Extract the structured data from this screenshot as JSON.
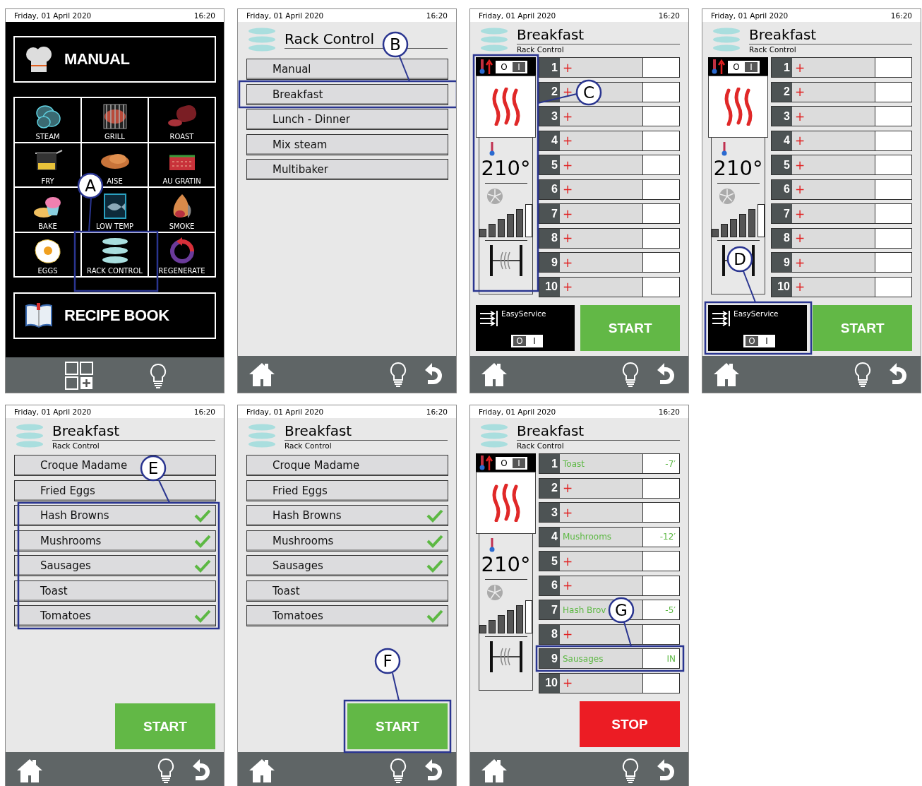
{
  "screens": [
    {
      "kind": "home",
      "date": "Friday, 01 April 2020",
      "time": "16:20",
      "manual": "MANUAL",
      "recipe_book": "RECIPE BOOK",
      "callout": "A",
      "tiles": [
        {
          "label": "STEAM"
        },
        {
          "label": "GRILL"
        },
        {
          "label": "ROAST"
        },
        {
          "label": "FRY"
        },
        {
          "label": "AISE"
        },
        {
          "label": "AU GRATIN"
        },
        {
          "label": "BAKE"
        },
        {
          "label": "LOW TEMP"
        },
        {
          "label": "SMOKE"
        },
        {
          "label": "EGGS"
        },
        {
          "label": "RACK CONTROL"
        },
        {
          "label": "REGENERATE"
        }
      ]
    },
    {
      "kind": "menu",
      "date": "Friday, 01 April 2020",
      "time": "16:20",
      "title": "Rack Control",
      "callout": "B",
      "items": [
        {
          "label": "Manual"
        },
        {
          "label": "Breakfast"
        },
        {
          "label": "Lunch - Dinner"
        },
        {
          "label": "Mix steam"
        },
        {
          "label": "Multibaker"
        }
      ]
    },
    {
      "kind": "racks",
      "date": "Friday, 01 April 2020",
      "time": "16:20",
      "title": "Breakfast",
      "subtitle": "Rack Control",
      "callout": "C",
      "heat_toggle": {
        "off": "O",
        "on_label": "I",
        "on": true
      },
      "temperature": "210°",
      "fan": {
        "level": 0.83
      },
      "racks": [
        {
          "number": "1",
          "kind": "empty",
          "label": "+"
        },
        {
          "number": "2",
          "kind": "empty",
          "label": "+"
        },
        {
          "number": "3",
          "kind": "empty",
          "label": "+"
        },
        {
          "number": "4",
          "kind": "empty",
          "label": "+"
        },
        {
          "number": "5",
          "kind": "empty",
          "label": "+"
        },
        {
          "number": "6",
          "kind": "empty",
          "label": "+"
        },
        {
          "number": "7",
          "kind": "empty",
          "label": "+"
        },
        {
          "number": "8",
          "kind": "empty",
          "label": "+"
        },
        {
          "number": "9",
          "kind": "empty",
          "label": "+"
        },
        {
          "number": "10",
          "kind": "empty",
          "label": "+"
        }
      ],
      "easy_service": {
        "label": "EasyService",
        "off": "O",
        "on_label": "I",
        "on": false
      },
      "action": {
        "kind": "start",
        "label": "START"
      }
    },
    {
      "kind": "racks",
      "date": "Friday, 01 April 2020",
      "time": "16:20",
      "title": "Breakfast",
      "subtitle": "Rack Control",
      "callout": "D",
      "heat_toggle": {
        "off": "O",
        "on_label": "I",
        "on": true
      },
      "temperature": "210°",
      "fan": {
        "level": 0.83
      },
      "racks": [
        {
          "number": "1",
          "kind": "empty",
          "label": "+"
        },
        {
          "number": "2",
          "kind": "empty",
          "label": "+"
        },
        {
          "number": "3",
          "kind": "empty",
          "label": "+"
        },
        {
          "number": "4",
          "kind": "empty",
          "label": "+"
        },
        {
          "number": "5",
          "kind": "empty",
          "label": "+"
        },
        {
          "number": "6",
          "kind": "empty",
          "label": "+"
        },
        {
          "number": "7",
          "kind": "empty",
          "label": "+"
        },
        {
          "number": "8",
          "kind": "empty",
          "label": "+"
        },
        {
          "number": "9",
          "kind": "empty",
          "label": "+"
        },
        {
          "number": "10",
          "kind": "empty",
          "label": "+"
        }
      ],
      "easy_service": {
        "label": "EasyService",
        "off": "O",
        "on_label": "I",
        "on": false
      },
      "action": {
        "kind": "start",
        "label": "START"
      }
    },
    {
      "kind": "recipes",
      "date": "Friday, 01 April 2020",
      "time": "16:20",
      "title": "Breakfast",
      "subtitle": "Rack Control",
      "callout": "E",
      "items": [
        {
          "label": "Croque Madame",
          "checked": false
        },
        {
          "label": "Fried Eggs",
          "checked": false
        },
        {
          "label": "Hash Browns",
          "checked": true
        },
        {
          "label": "Mushrooms",
          "checked": true
        },
        {
          "label": "Sausages",
          "checked": true
        },
        {
          "label": "Toast",
          "checked": false
        },
        {
          "label": "Tomatoes",
          "checked": true
        }
      ],
      "action": {
        "kind": "start",
        "label": "START"
      }
    },
    {
      "kind": "recipes",
      "date": "Friday, 01 April 2020",
      "time": "16:20",
      "title": "Breakfast",
      "subtitle": "Rack Control",
      "callout": "F",
      "items": [
        {
          "label": "Croque Madame",
          "checked": false
        },
        {
          "label": "Fried Eggs",
          "checked": false
        },
        {
          "label": "Hash Browns",
          "checked": true
        },
        {
          "label": "Mushrooms",
          "checked": true
        },
        {
          "label": "Sausages",
          "checked": true
        },
        {
          "label": "Toast",
          "checked": false
        },
        {
          "label": "Tomatoes",
          "checked": true
        }
      ],
      "action": {
        "kind": "start",
        "label": "START"
      }
    },
    {
      "kind": "racks",
      "date": "Friday, 01 April 2020",
      "time": "16:20",
      "title": "Breakfast",
      "subtitle": "Rack Control",
      "callout": "G",
      "heat_toggle": {
        "off": "O",
        "on_label": "I",
        "on": true
      },
      "temperature": "210°",
      "fan": {
        "level": 0.83
      },
      "racks": [
        {
          "number": "1",
          "kind": "loaded",
          "label": "Toast",
          "time": "-7′"
        },
        {
          "number": "2",
          "kind": "empty",
          "label": "+"
        },
        {
          "number": "3",
          "kind": "empty",
          "label": "+"
        },
        {
          "number": "4",
          "kind": "loaded",
          "label": "Mushrooms",
          "time": "-12′"
        },
        {
          "number": "5",
          "kind": "empty",
          "label": "+"
        },
        {
          "number": "6",
          "kind": "empty",
          "label": "+"
        },
        {
          "number": "7",
          "kind": "loaded",
          "label": "Hash Brov",
          "time": "-5′"
        },
        {
          "number": "8",
          "kind": "empty",
          "label": "+"
        },
        {
          "number": "9",
          "kind": "loaded",
          "label": "Sausages",
          "time": "IN"
        },
        {
          "number": "10",
          "kind": "empty",
          "label": "+"
        }
      ],
      "action": {
        "kind": "stop",
        "label": "STOP"
      }
    }
  ]
}
